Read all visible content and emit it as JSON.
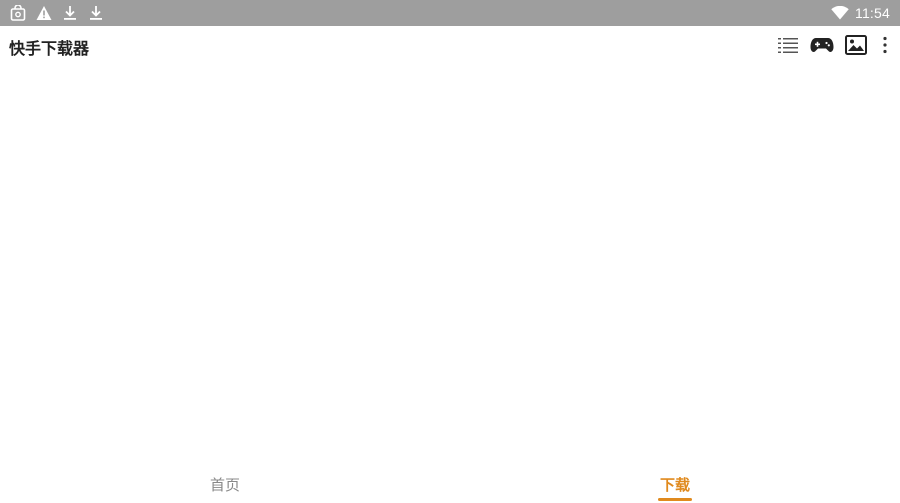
{
  "status_bar": {
    "time": "11:54",
    "left_icons": [
      "bag-icon",
      "warning-icon",
      "download-icon",
      "download-icon"
    ],
    "right_icons": [
      "wifi-icon"
    ]
  },
  "app_bar": {
    "title": "快手下载器",
    "actions": [
      "list-icon",
      "gamepad-icon",
      "image-icon",
      "more-vert-icon"
    ]
  },
  "bottom_nav": {
    "tabs": [
      {
        "label": "首页",
        "active": false
      },
      {
        "label": "下载",
        "active": true
      }
    ]
  },
  "colors": {
    "status_bar_bg": "#9e9e9e",
    "accent": "#e08a1e",
    "inactive_tab": "#888888",
    "title": "#222222"
  }
}
